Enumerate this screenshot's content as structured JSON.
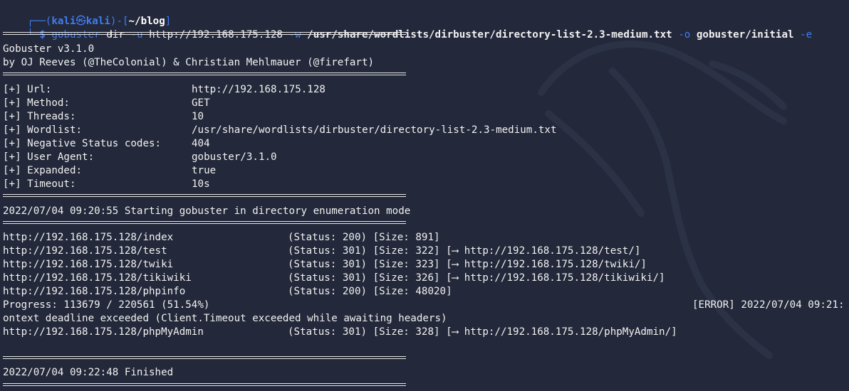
{
  "prompt": {
    "corner_top": "┌──(",
    "user": "kali",
    "at_symbol": "㉿",
    "host": "kali",
    "sep": ")-[",
    "cwd": "~/blog",
    "close": "]",
    "corner_bottom": "└─",
    "dollar": "$"
  },
  "command": {
    "program": "gobuster",
    "subcommand": "dir",
    "flag_u": "-u",
    "url": "http://192.168.175.128",
    "flag_w": "-w",
    "wordlist": "/usr/share/wordlists/dirbuster/directory-list-2.3-medium.txt",
    "flag_o": "-o",
    "output": "gobuster/initial",
    "flag_e": "-e"
  },
  "banner": {
    "version": "Gobuster v3.1.0",
    "authors": "by OJ Reeves (@TheColonial) & Christian Mehlmauer (@firefart)"
  },
  "config": [
    {
      "key": "[+] Url:",
      "value": "http://192.168.175.128"
    },
    {
      "key": "[+] Method:",
      "value": "GET"
    },
    {
      "key": "[+] Threads:",
      "value": "10"
    },
    {
      "key": "[+] Wordlist:",
      "value": "/usr/share/wordlists/dirbuster/directory-list-2.3-medium.txt"
    },
    {
      "key": "[+] Negative Status codes:",
      "value": "404"
    },
    {
      "key": "[+] User Agent:",
      "value": "gobuster/3.1.0"
    },
    {
      "key": "[+] Expanded:",
      "value": "true"
    },
    {
      "key": "[+] Timeout:",
      "value": "10s"
    }
  ],
  "start_message": "2022/07/04 09:20:55 Starting gobuster in directory enumeration mode",
  "results": [
    {
      "path": "http://192.168.175.128/index",
      "status": "(Status: 200) [Size: 891]"
    },
    {
      "path": "http://192.168.175.128/test",
      "status": "(Status: 301) [Size: 322] [⟶ http://192.168.175.128/test/]"
    },
    {
      "path": "http://192.168.175.128/twiki",
      "status": "(Status: 301) [Size: 323] [⟶ http://192.168.175.128/twiki/]"
    },
    {
      "path": "http://192.168.175.128/tikiwiki",
      "status": "(Status: 301) [Size: 326] [⟶ http://192.168.175.128/tikiwiki/]"
    },
    {
      "path": "http://192.168.175.128/phpinfo",
      "status": "(Status: 200) [Size: 48020]"
    }
  ],
  "progress": "Progress: 113679 / 220561 (51.54%)",
  "error_prefix": "[ERROR] 2022/07/04 09:21:",
  "error_message": "ontext deadline exceeded (Client.Timeout exceeded while awaiting headers)",
  "result_after": {
    "path": "http://192.168.175.128/phpMyAdmin",
    "status": "(Status: 301) [Size: 328] [⟶ http://192.168.175.128/phpMyAdmin/]"
  },
  "finished": "2022/07/04 09:22:48 Finished",
  "colors": {
    "background": "#23283a",
    "prompt": "#3f7df2",
    "text": "#f2f2f2"
  }
}
